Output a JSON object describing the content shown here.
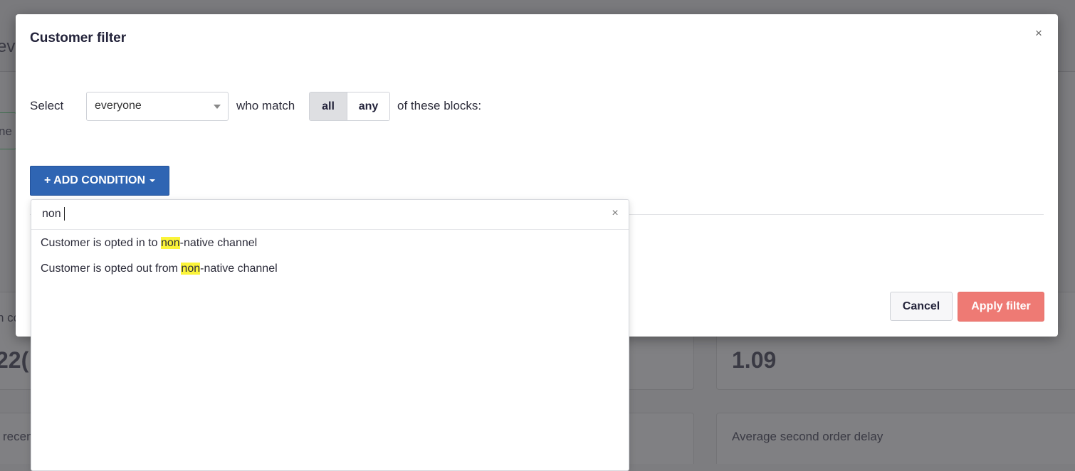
{
  "background": {
    "heading_fragment": "ev",
    "chip_fragment": "ne",
    "cards": [
      {
        "label_fragment": "n co",
        "value_fragment": "22("
      },
      {
        "label": "",
        "value": "1.09"
      },
      {
        "label_fragment": "recen",
        "value": ""
      },
      {
        "label": "Average second order delay",
        "value": ""
      }
    ]
  },
  "modal": {
    "title": "Customer filter",
    "close_symbol": "×",
    "select_label": "Select",
    "audience_value": "everyone",
    "match_label": "who match",
    "match_options": [
      "all",
      "any"
    ],
    "match_selected": "all",
    "suffix_label": "of these blocks:",
    "add_condition_label": "+ ADD CONDITION",
    "cancel_label": "Cancel",
    "apply_label": "Apply filter"
  },
  "dropdown": {
    "search_value": "non",
    "clear_symbol": "×",
    "results": [
      {
        "before": "Customer is opted in to ",
        "match": "non",
        "after": "-native channel"
      },
      {
        "before": "Customer is opted out from ",
        "match": "non",
        "after": "-native channel"
      }
    ]
  },
  "colors": {
    "primary_button": "#2f65b3",
    "apply_button": "#ee7a74",
    "highlight": "#fbf43a",
    "overlay": "#7d7d80"
  }
}
